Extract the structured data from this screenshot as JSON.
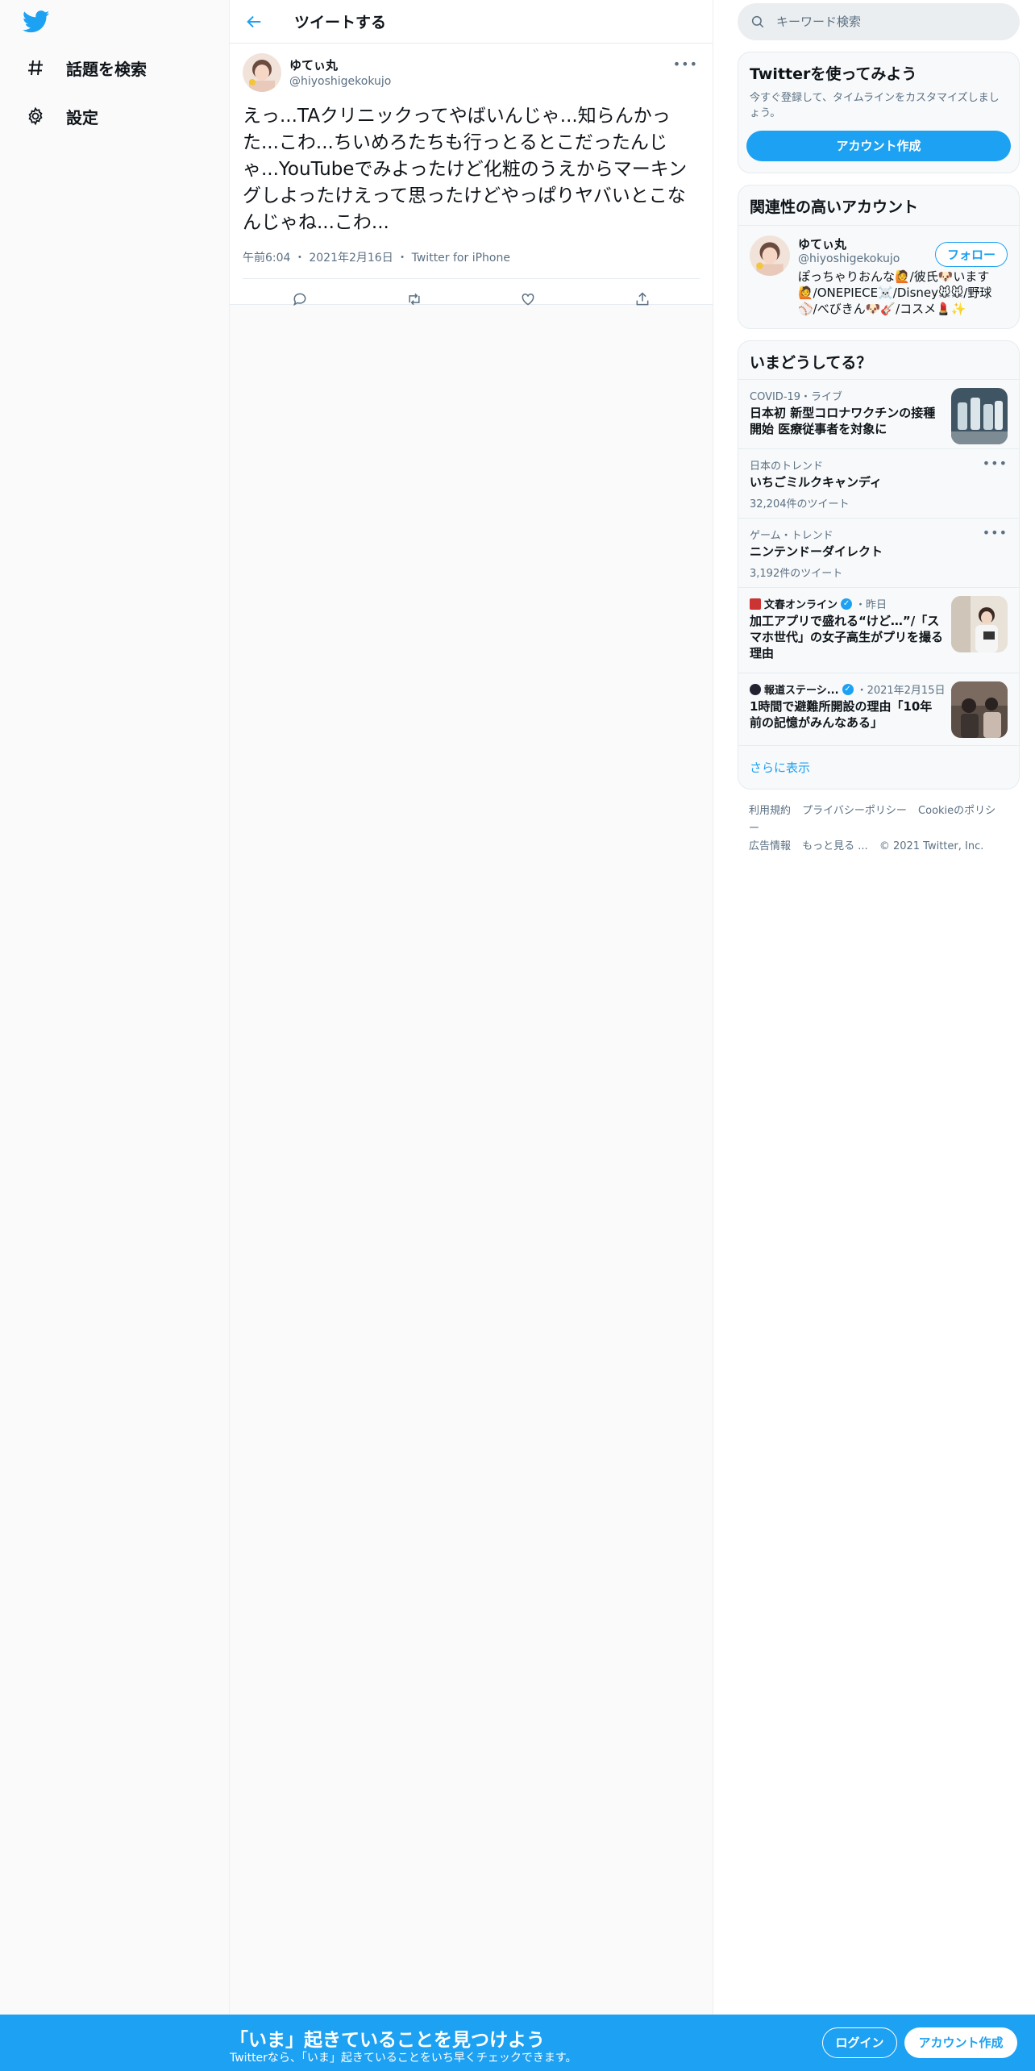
{
  "nav": {
    "logo": "twitter-bird-icon",
    "items": [
      {
        "label": "話題を検索",
        "icon": "hashtag-icon"
      },
      {
        "label": "設定",
        "icon": "gear-icon"
      }
    ]
  },
  "header": {
    "title": "ツイートする"
  },
  "tweet": {
    "name": "ゆてぃ丸",
    "handle": "@hiyoshigekokujo",
    "text": "えっ...TAクリニックってやばいんじゃ...知らんかった...こわ...ちいめろたちも行っとるとこだったんじゃ...YouTubeでみよったけど化粧のうえからマーキングしよったけえって思ったけどやっぱりヤバいとこなんじゃね...こわ...",
    "time": "午前6:04",
    "date": "2021年2月16日",
    "source": "Twitter for iPhone"
  },
  "search": {
    "placeholder": "キーワード検索"
  },
  "signup": {
    "title": "Twitterを使ってみよう",
    "subtitle": "今すぐ登録して、タイムラインをカスタマイズしましょう。",
    "button": "アカウント作成"
  },
  "related": {
    "title": "関連性の高いアカウント",
    "name": "ゆてぃ丸",
    "handle": "@hiyoshigekokujo",
    "follow": "フォロー",
    "bio": "ぽっちゃりおんな🙋/彼氏🐶います🙋/ONEPIECE☠️/Disney🐭🐭/野球⚾/べびきん🐶🎸/コスメ💄✨"
  },
  "trends": {
    "title": "いまどうしてる？",
    "items": [
      {
        "meta": "COVID-19・ライブ",
        "title": "日本初 新型コロナワクチンの接種開始 医療従事者を対象に"
      },
      {
        "meta": "日本のトレンド",
        "title": "いちごミルクキャンディ",
        "count": "32,204件のツイート"
      },
      {
        "meta": "ゲーム・トレンド",
        "title": "ニンテンドーダイレクト",
        "count": "3,192件のツイート"
      },
      {
        "meta": "文春オンライン",
        "meta2": "・昨日",
        "title": "加工アプリで盛れる“けど…”/「スマホ世代」の女子高生がプリを撮る理由"
      },
      {
        "meta": "報道ステーシ...",
        "meta2": "・2021年2月15日",
        "title": "1時間で避難所開設の理由「10年前の記憶がみんなある」"
      }
    ],
    "show_more": "さらに表示"
  },
  "footer": {
    "links": [
      "利用規約",
      "プライバシーポリシー",
      "Cookieのポリシー",
      "広告情報",
      "もっと見る ..."
    ],
    "copyright": "© 2021 Twitter, Inc."
  },
  "bottombar": {
    "title": "「いま」起きていることを見つけよう",
    "subtitle": "Twitterなら、「いま」起きていることをいち早くチェックできます。",
    "login": "ログイン",
    "signup": "アカウント作成"
  },
  "colors": {
    "accent": "#1da1f2",
    "muted": "#5b7083",
    "text": "#0f1419"
  }
}
